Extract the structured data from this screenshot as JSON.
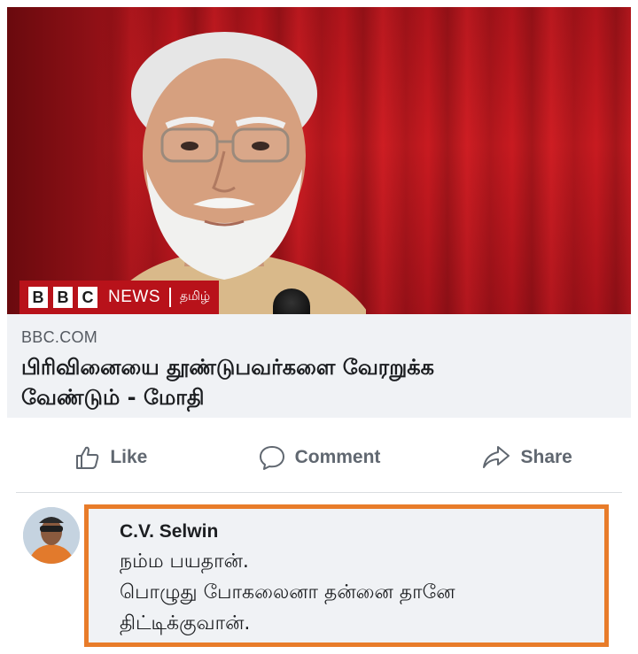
{
  "post": {
    "image": {
      "description_icon": "person-portrait",
      "badge": {
        "b1": "B",
        "b2": "B",
        "b3": "C",
        "news": "NEWS",
        "language": "தமிழ்"
      }
    },
    "link": {
      "domain": "BBC.COM",
      "title_line1": "பிரிவினையை தூண்டுபவர்களை வேரறுக்க",
      "title_line2": "வேண்டும் - மோதி"
    },
    "actions": {
      "like": "Like",
      "comment": "Comment",
      "share": "Share"
    }
  },
  "comment": {
    "author": "C.V. Selwin",
    "lines": [
      "நம்ம பயதான்.",
      "பொழுது போகலைனா தன்னை தானே",
      "திட்டிக்குவான்."
    ],
    "highlight_color": "#e87c2a"
  },
  "colors": {
    "bbc_red": "#b8121a",
    "action_gray": "#606770",
    "preview_bg": "#f0f2f5"
  }
}
